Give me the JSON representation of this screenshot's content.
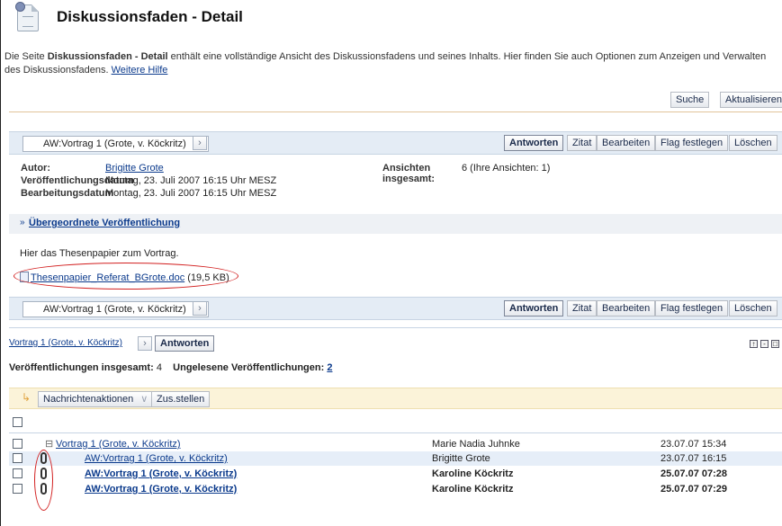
{
  "header": {
    "title": "Diskussionsfaden - Detail"
  },
  "description": {
    "prefix": "Die Seite ",
    "bold": "Diskussionsfaden - Detail",
    "text": " enthält eine vollständige Ansicht des Diskussionsfadens und seines Inhalts. Hier finden Sie auch Optionen zum Anzeigen und Verwalten des Diskussionsfadens.",
    "help_link": "Weitere Hilfe"
  },
  "top_actions": {
    "search": "Suche",
    "refresh": "Aktualisieren"
  },
  "post_toolbar": {
    "post_title": "AW:Vortrag 1 (Grote, v. Köckritz)",
    "reply": "Antworten",
    "quote": "Zitat",
    "edit": "Bearbeiten",
    "flag": "Flag festlegen",
    "delete": "Löschen"
  },
  "post_meta": {
    "author_label": "Autor:",
    "author": "Brigitte Grote",
    "published_label": "Veröffentlichungsdatum",
    "published": "Montag, 23. Juli 2007 16:15 Uhr MESZ",
    "edited_label": "Bearbeitungsdatum",
    "edited": "Montag, 23. Juli 2007 16:15 Uhr MESZ",
    "views_label_1": "Ansichten",
    "views_label_2": "insgesamt:",
    "views": "6 (Ihre Ansichten: 1)"
  },
  "parent_link": "Übergeordnete Veröffentlichung",
  "post_body": {
    "text": "Hier das Thesenpapier zum Vortrag.",
    "attachment_name": "Thesenpapier_Referat_BGrote.doc",
    "attachment_size": "(19,5 KB)"
  },
  "thread_nav": {
    "link": "Vortrag 1 (Grote, v. Köckritz)",
    "reply": "Antworten"
  },
  "summary": {
    "total_label": "Veröffentlichungen insgesamt:",
    "total": "4",
    "unread_label": "Ungelesene Veröffentlichungen:",
    "unread": "2"
  },
  "message_actions": {
    "actions": "Nachrichtenaktionen",
    "collapse": "Zus.stellen"
  },
  "thread_rows": [
    {
      "title": "Vortrag 1 (Grote, v. Köckritz)",
      "author": "Marie Nadia Juhnke",
      "date": "23.07.07 15:34",
      "unread": false,
      "attachment": false
    },
    {
      "title": "AW:Vortrag 1 (Grote, v. Köckritz)",
      "author": "Brigitte Grote",
      "date": "23.07.07 16:15",
      "unread": false,
      "attachment": true
    },
    {
      "title": "AW:Vortrag 1 (Grote, v. Köckritz)",
      "author": "Karoline Köckritz",
      "date": "25.07.07 07:28",
      "unread": true,
      "attachment": true
    },
    {
      "title": "AW:Vortrag 1 (Grote, v. Köckritz)",
      "author": "Karoline Köckritz",
      "date": "25.07.07 07:29",
      "unread": true,
      "attachment": true
    }
  ],
  "colors": {
    "annotation_red": "#d21f1f",
    "toolbar_blue": "#e4ecf5",
    "actions_yellow": "#fbf3d9"
  }
}
